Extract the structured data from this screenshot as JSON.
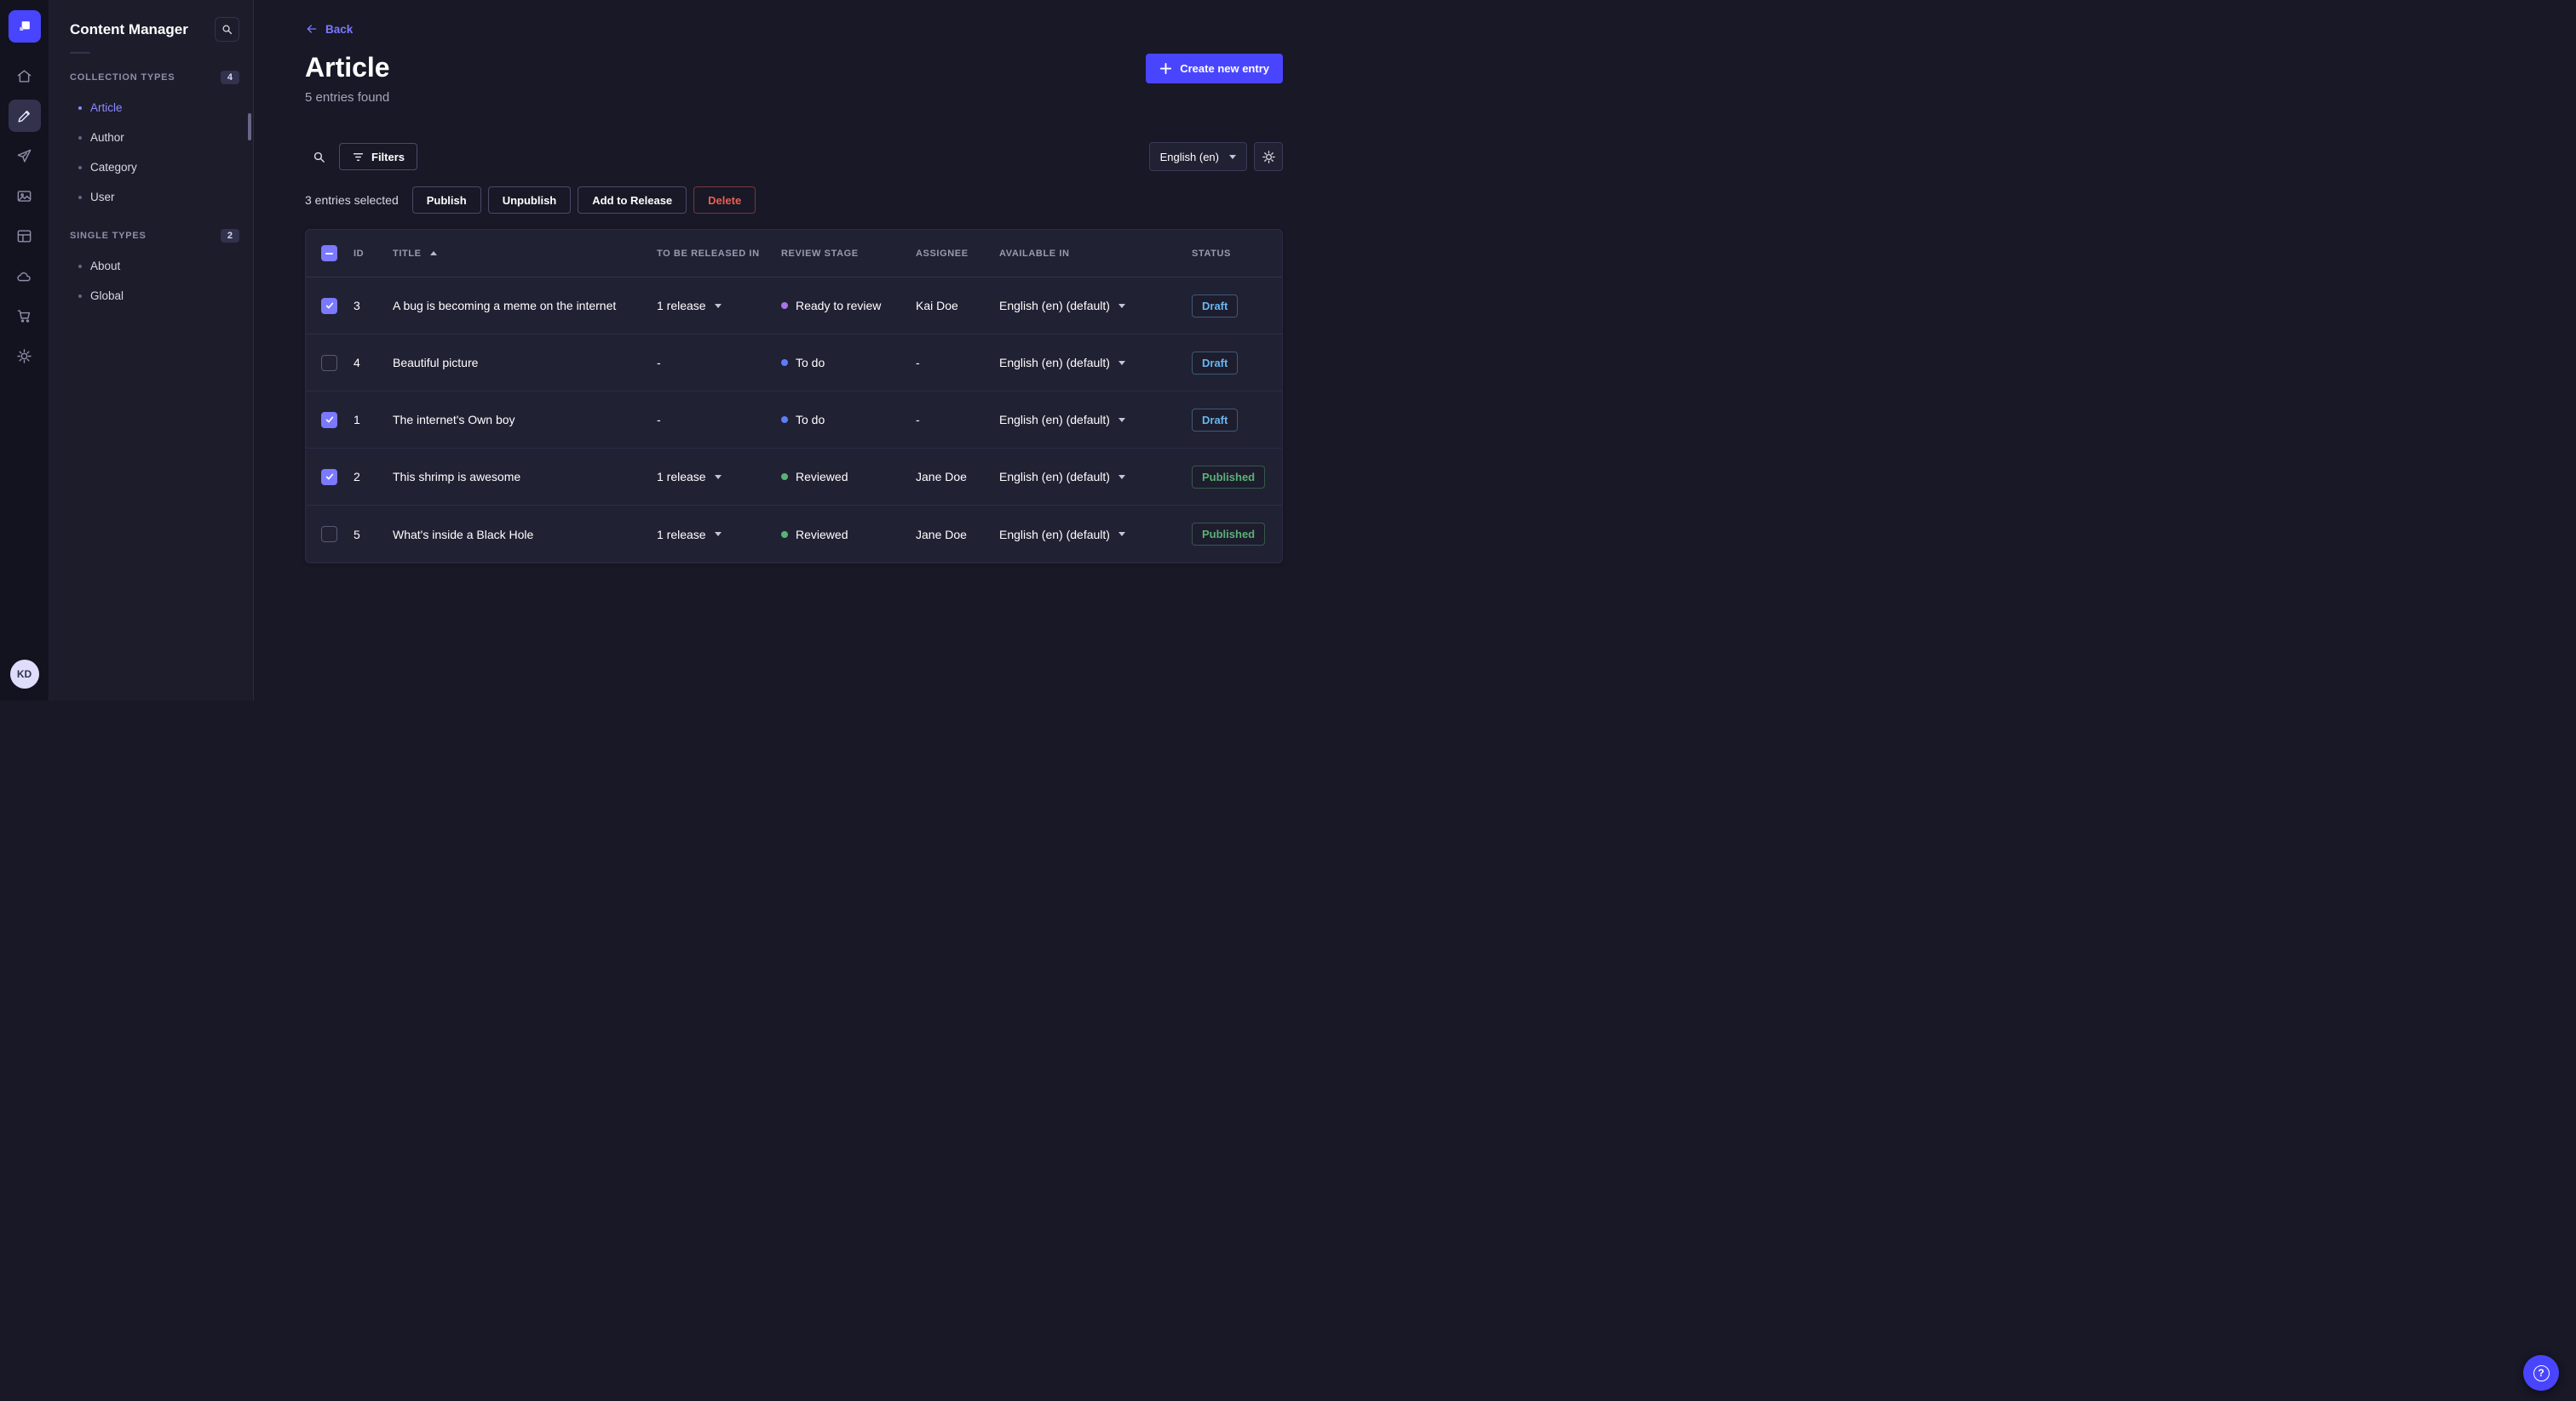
{
  "colors": {
    "primary": "#4945ff",
    "link": "#7b79ff",
    "draft_status": "#66b7f1",
    "published_status": "#5cb176",
    "checkbox_checked": "#7b79ff"
  },
  "nav_rail": {
    "icons": [
      "strapi-logo",
      "home",
      "content-manager",
      "releases",
      "media-library",
      "content-type-builder",
      "deploy",
      "marketplace",
      "settings"
    ],
    "active_icon": "content-manager",
    "avatar_initials": "KD"
  },
  "sidebar": {
    "title": "Content Manager",
    "sections": [
      {
        "label": "COLLECTION TYPES",
        "badge": "4",
        "items": [
          {
            "label": "Article",
            "active": true
          },
          {
            "label": "Author",
            "active": false
          },
          {
            "label": "Category",
            "active": false
          },
          {
            "label": "User",
            "active": false
          }
        ]
      },
      {
        "label": "SINGLE TYPES",
        "badge": "2",
        "items": [
          {
            "label": "About",
            "active": false
          },
          {
            "label": "Global",
            "active": false
          }
        ]
      }
    ]
  },
  "header": {
    "back_label": "Back",
    "title": "Article",
    "subtitle": "5 entries found",
    "create_button_label": "Create new entry"
  },
  "toolbar": {
    "filters_label": "Filters",
    "locale_label": "English (en)"
  },
  "selection": {
    "count_label": "3 entries selected",
    "publish_label": "Publish",
    "unpublish_label": "Unpublish",
    "add_to_release_label": "Add to Release",
    "delete_label": "Delete"
  },
  "table": {
    "columns": [
      "ID",
      "TITLE",
      "TO BE RELEASED IN",
      "REVIEW STAGE",
      "ASSIGNEE",
      "AVAILABLE IN",
      "STATUS"
    ],
    "sort": {
      "column": "TITLE",
      "direction": "asc"
    },
    "select_all_state": "indeterminate",
    "rows": [
      {
        "checked": true,
        "id": "3",
        "title": "A bug is becoming a meme on the internet",
        "to_be_released_in": "1 release",
        "release_caret": true,
        "review_stage": "Ready to review",
        "review_color": "#ac73e6",
        "assignee": "Kai Doe",
        "available_in": "English (en) (default)",
        "status": "Draft",
        "status_color": "#66b7f1"
      },
      {
        "checked": false,
        "id": "4",
        "title": "Beautiful picture",
        "to_be_released_in": "-",
        "release_caret": false,
        "review_stage": "To do",
        "review_color": "#5c7cfa",
        "assignee": "-",
        "available_in": "English (en) (default)",
        "status": "Draft",
        "status_color": "#66b7f1"
      },
      {
        "checked": true,
        "id": "1",
        "title": "The internet's Own boy",
        "to_be_released_in": "-",
        "release_caret": false,
        "review_stage": "To do",
        "review_color": "#5c7cfa",
        "assignee": "-",
        "available_in": "English (en) (default)",
        "status": "Draft",
        "status_color": "#66b7f1"
      },
      {
        "checked": true,
        "id": "2",
        "title": "This shrimp is awesome",
        "to_be_released_in": "1 release",
        "release_caret": true,
        "review_stage": "Reviewed",
        "review_color": "#5cb176",
        "assignee": "Jane Doe",
        "available_in": "English (en) (default)",
        "status": "Published",
        "status_color": "#5cb176"
      },
      {
        "checked": false,
        "id": "5",
        "title": "What's inside a Black Hole",
        "to_be_released_in": "1 release",
        "release_caret": true,
        "review_stage": "Reviewed",
        "review_color": "#5cb176",
        "assignee": "Jane Doe",
        "available_in": "English (en) (default)",
        "status": "Published",
        "status_color": "#5cb176"
      }
    ]
  },
  "help": {
    "question_mark": "?"
  }
}
